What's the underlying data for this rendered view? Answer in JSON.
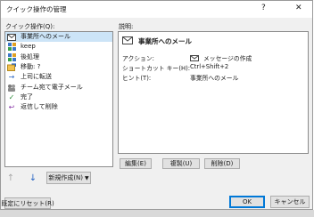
{
  "window": {
    "title": "クイック操作の管理",
    "help": "?",
    "close": "✕"
  },
  "left": {
    "label": "クイック操作(Q):",
    "items": [
      {
        "icon": "envelope-icon",
        "label": "事業所へのメール",
        "selected": true
      },
      {
        "icon": "grid-icon",
        "label": "keep"
      },
      {
        "icon": "grid-icon",
        "label": "後処理"
      },
      {
        "icon": "folder-move-icon",
        "label": "移動: ?"
      },
      {
        "icon": "forward-arrow-icon",
        "label": "上司に転送"
      },
      {
        "icon": "team-mail-icon",
        "label": "チーム宛て電子メール"
      },
      {
        "icon": "checkmark-icon",
        "label": "完了"
      },
      {
        "icon": "reply-delete-icon",
        "label": "返信して削除"
      }
    ],
    "new_button": "新規作成(N)",
    "reset_button": "既定にリセット(R)"
  },
  "right": {
    "label": "説明:",
    "action_name": "事業所へのメール",
    "props": [
      {
        "key": "アクション:",
        "value": "メッセージの作成",
        "has_icon": true
      },
      {
        "key": "ショートカット キー(H):",
        "value": "Ctrl+Shift+2"
      },
      {
        "key": "ヒント(T):",
        "value": "事業所へのメール"
      }
    ],
    "edit_button": "編集(E)",
    "duplicate_button": "複製(U)",
    "delete_button": "削除(D)"
  },
  "footer": {
    "ok": "OK",
    "cancel": "キャンセル"
  },
  "colors": {
    "selection": "#cce4f7",
    "accent": "#0078d7"
  }
}
